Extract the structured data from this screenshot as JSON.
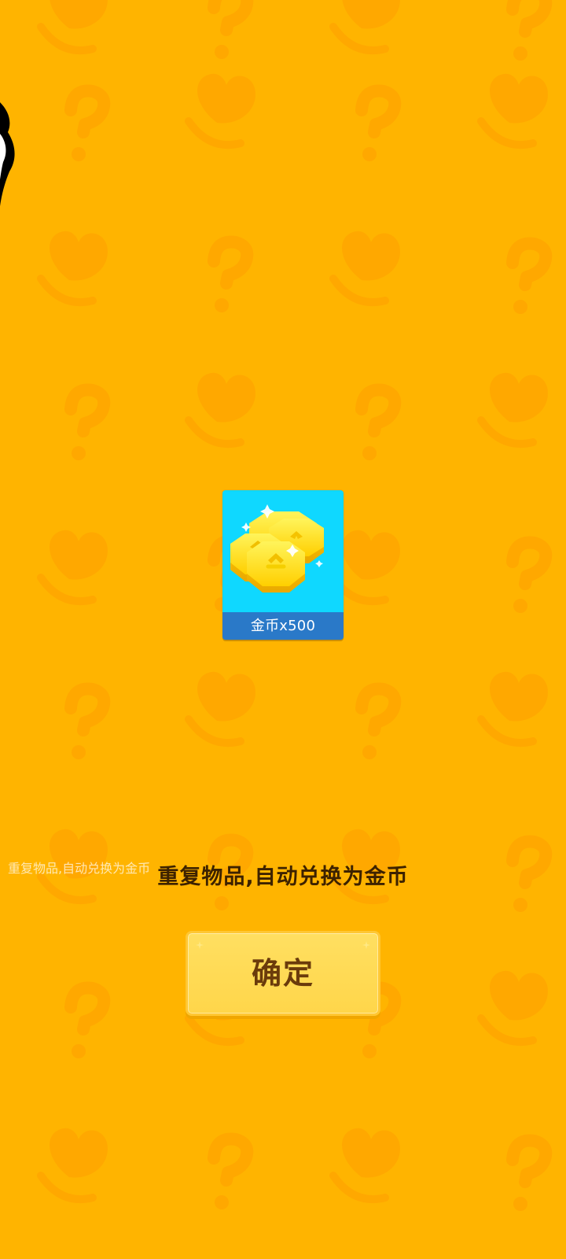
{
  "reward": {
    "item_name": "金币x500",
    "icon": "gold-coins-icon",
    "card_color": "#0fd8ff",
    "label_color": "#2a79c8"
  },
  "message": {
    "text": "重复物品,自动兑换为金币"
  },
  "actions": {
    "confirm_label": "确定"
  },
  "theme": {
    "background": "#ffb400",
    "pattern": "#ffa700",
    "button": "#ffd64a",
    "button_text": "#6b3b0b"
  }
}
